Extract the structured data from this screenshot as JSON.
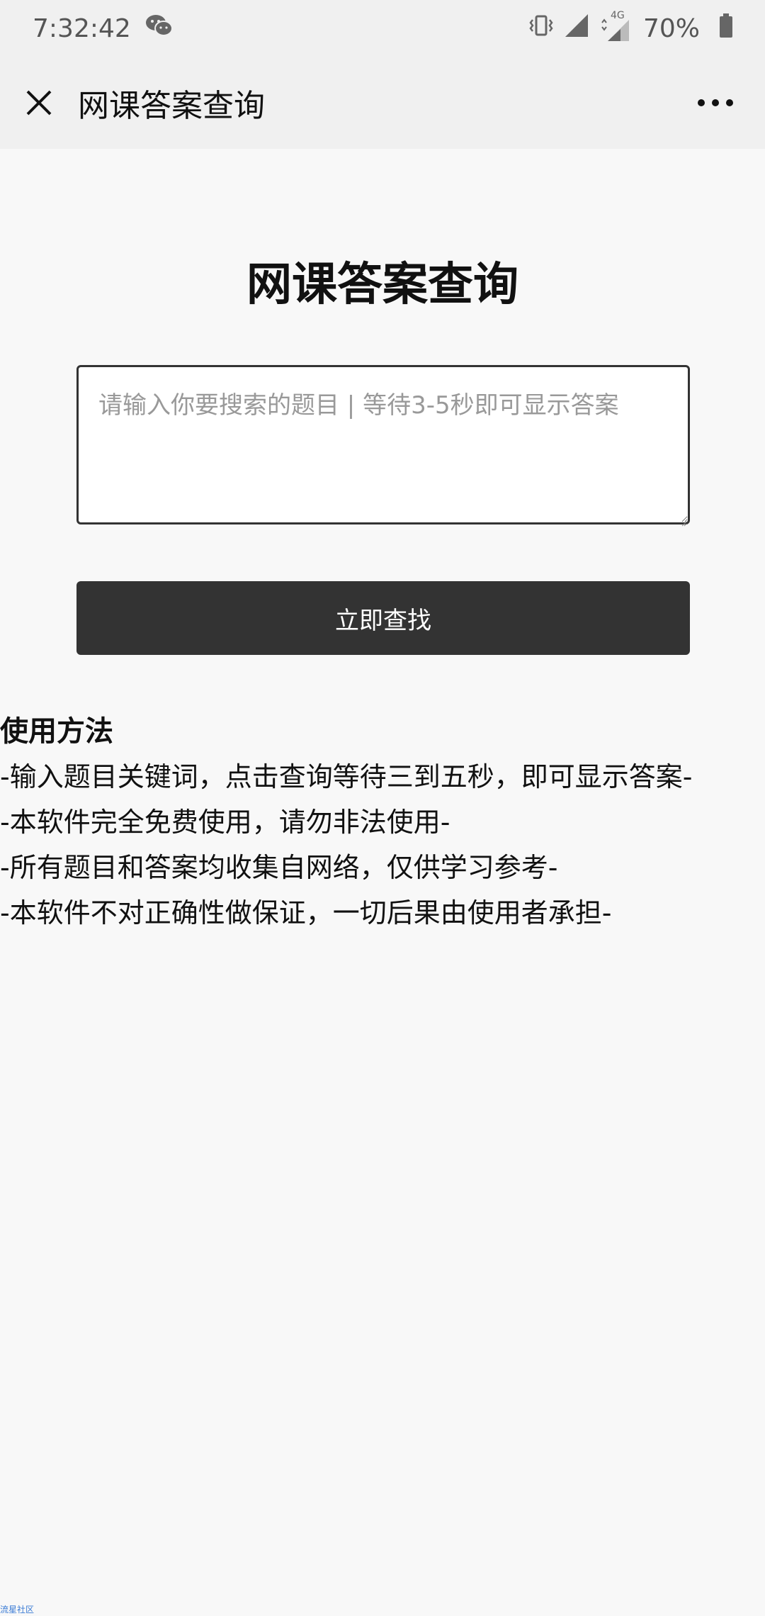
{
  "status_bar": {
    "time": "7:32:42",
    "network_type": "4G",
    "battery": "70%",
    "icons": [
      "wechat-icon",
      "vibrate-icon",
      "signal-icon",
      "data-signal-icon",
      "battery-icon"
    ]
  },
  "app_bar": {
    "title": "网课答案查询",
    "close_icon": "close-icon",
    "more_icon": "more-dots-icon"
  },
  "main": {
    "page_title": "网课答案查询",
    "search_placeholder": "请输入你要搜索的题目 | 等待3-5秒即可显示答案",
    "search_value": "",
    "search_button": "立即查找",
    "usage_title": "使用方法",
    "usage_lines": [
      "-输入题目关键词，点击查询等待三到五秒，即可显示答案-",
      "-本软件完全免费使用，请勿非法使用-",
      "-所有题目和答案均收集自网络，仅供学习参考-",
      "-本软件不对正确性做保证，一切后果由使用者承担-"
    ]
  },
  "watermark": "流星社区",
  "colors": {
    "button_bg": "#333333",
    "button_text": "#ffffff",
    "page_bg": "#f8f8f8",
    "app_bar_bg": "#f0f0f0"
  }
}
